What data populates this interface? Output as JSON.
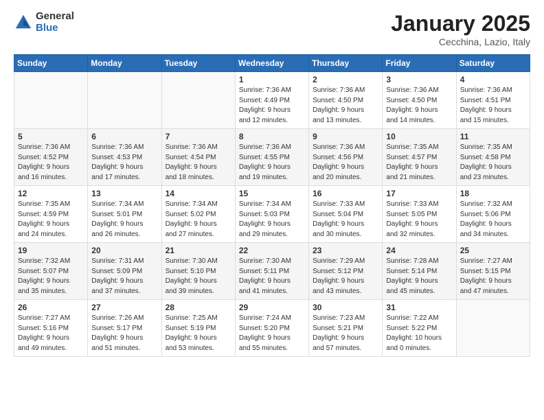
{
  "header": {
    "logo_general": "General",
    "logo_blue": "Blue",
    "title": "January 2025",
    "location": "Cecchina, Lazio, Italy"
  },
  "weekdays": [
    "Sunday",
    "Monday",
    "Tuesday",
    "Wednesday",
    "Thursday",
    "Friday",
    "Saturday"
  ],
  "weeks": [
    [
      {
        "day": "",
        "info": ""
      },
      {
        "day": "",
        "info": ""
      },
      {
        "day": "",
        "info": ""
      },
      {
        "day": "1",
        "info": "Sunrise: 7:36 AM\nSunset: 4:49 PM\nDaylight: 9 hours\nand 12 minutes."
      },
      {
        "day": "2",
        "info": "Sunrise: 7:36 AM\nSunset: 4:50 PM\nDaylight: 9 hours\nand 13 minutes."
      },
      {
        "day": "3",
        "info": "Sunrise: 7:36 AM\nSunset: 4:50 PM\nDaylight: 9 hours\nand 14 minutes."
      },
      {
        "day": "4",
        "info": "Sunrise: 7:36 AM\nSunset: 4:51 PM\nDaylight: 9 hours\nand 15 minutes."
      }
    ],
    [
      {
        "day": "5",
        "info": "Sunrise: 7:36 AM\nSunset: 4:52 PM\nDaylight: 9 hours\nand 16 minutes."
      },
      {
        "day": "6",
        "info": "Sunrise: 7:36 AM\nSunset: 4:53 PM\nDaylight: 9 hours\nand 17 minutes."
      },
      {
        "day": "7",
        "info": "Sunrise: 7:36 AM\nSunset: 4:54 PM\nDaylight: 9 hours\nand 18 minutes."
      },
      {
        "day": "8",
        "info": "Sunrise: 7:36 AM\nSunset: 4:55 PM\nDaylight: 9 hours\nand 19 minutes."
      },
      {
        "day": "9",
        "info": "Sunrise: 7:36 AM\nSunset: 4:56 PM\nDaylight: 9 hours\nand 20 minutes."
      },
      {
        "day": "10",
        "info": "Sunrise: 7:35 AM\nSunset: 4:57 PM\nDaylight: 9 hours\nand 21 minutes."
      },
      {
        "day": "11",
        "info": "Sunrise: 7:35 AM\nSunset: 4:58 PM\nDaylight: 9 hours\nand 23 minutes."
      }
    ],
    [
      {
        "day": "12",
        "info": "Sunrise: 7:35 AM\nSunset: 4:59 PM\nDaylight: 9 hours\nand 24 minutes."
      },
      {
        "day": "13",
        "info": "Sunrise: 7:34 AM\nSunset: 5:01 PM\nDaylight: 9 hours\nand 26 minutes."
      },
      {
        "day": "14",
        "info": "Sunrise: 7:34 AM\nSunset: 5:02 PM\nDaylight: 9 hours\nand 27 minutes."
      },
      {
        "day": "15",
        "info": "Sunrise: 7:34 AM\nSunset: 5:03 PM\nDaylight: 9 hours\nand 29 minutes."
      },
      {
        "day": "16",
        "info": "Sunrise: 7:33 AM\nSunset: 5:04 PM\nDaylight: 9 hours\nand 30 minutes."
      },
      {
        "day": "17",
        "info": "Sunrise: 7:33 AM\nSunset: 5:05 PM\nDaylight: 9 hours\nand 32 minutes."
      },
      {
        "day": "18",
        "info": "Sunrise: 7:32 AM\nSunset: 5:06 PM\nDaylight: 9 hours\nand 34 minutes."
      }
    ],
    [
      {
        "day": "19",
        "info": "Sunrise: 7:32 AM\nSunset: 5:07 PM\nDaylight: 9 hours\nand 35 minutes."
      },
      {
        "day": "20",
        "info": "Sunrise: 7:31 AM\nSunset: 5:09 PM\nDaylight: 9 hours\nand 37 minutes."
      },
      {
        "day": "21",
        "info": "Sunrise: 7:30 AM\nSunset: 5:10 PM\nDaylight: 9 hours\nand 39 minutes."
      },
      {
        "day": "22",
        "info": "Sunrise: 7:30 AM\nSunset: 5:11 PM\nDaylight: 9 hours\nand 41 minutes."
      },
      {
        "day": "23",
        "info": "Sunrise: 7:29 AM\nSunset: 5:12 PM\nDaylight: 9 hours\nand 43 minutes."
      },
      {
        "day": "24",
        "info": "Sunrise: 7:28 AM\nSunset: 5:14 PM\nDaylight: 9 hours\nand 45 minutes."
      },
      {
        "day": "25",
        "info": "Sunrise: 7:27 AM\nSunset: 5:15 PM\nDaylight: 9 hours\nand 47 minutes."
      }
    ],
    [
      {
        "day": "26",
        "info": "Sunrise: 7:27 AM\nSunset: 5:16 PM\nDaylight: 9 hours\nand 49 minutes."
      },
      {
        "day": "27",
        "info": "Sunrise: 7:26 AM\nSunset: 5:17 PM\nDaylight: 9 hours\nand 51 minutes."
      },
      {
        "day": "28",
        "info": "Sunrise: 7:25 AM\nSunset: 5:19 PM\nDaylight: 9 hours\nand 53 minutes."
      },
      {
        "day": "29",
        "info": "Sunrise: 7:24 AM\nSunset: 5:20 PM\nDaylight: 9 hours\nand 55 minutes."
      },
      {
        "day": "30",
        "info": "Sunrise: 7:23 AM\nSunset: 5:21 PM\nDaylight: 9 hours\nand 57 minutes."
      },
      {
        "day": "31",
        "info": "Sunrise: 7:22 AM\nSunset: 5:22 PM\nDaylight: 10 hours\nand 0 minutes."
      },
      {
        "day": "",
        "info": ""
      }
    ]
  ]
}
